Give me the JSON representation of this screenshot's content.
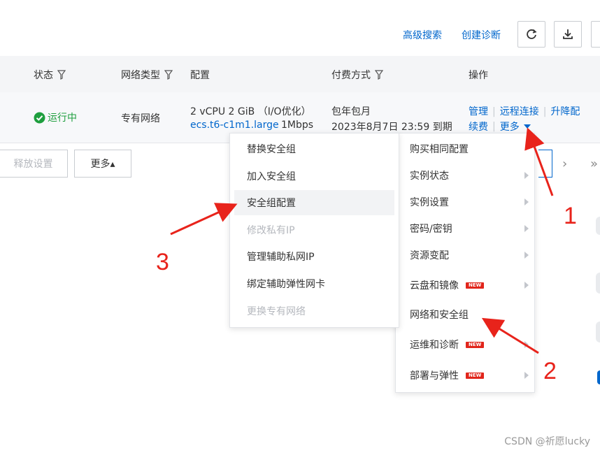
{
  "toolbar": {
    "advanced_search": "高级搜索",
    "create_diagnosis": "创建诊断"
  },
  "table": {
    "headers": {
      "status": "状态",
      "network_type": "网络类型",
      "config": "配置",
      "billing": "付费方式",
      "actions": "操作"
    },
    "row": {
      "status": "运行中",
      "network_type": "专有网络",
      "config_line1": "2 vCPU 2 GiB （I/O优化）",
      "instance_type": "ecs.t6-c1m1.large",
      "bandwidth": "1Mbps",
      "billing_line1": "包年包月",
      "billing_line2": "2023年8月7日 23:59 到期",
      "actions": {
        "manage": "管理",
        "remote_connect": "远程连接",
        "upgrade": "升降配",
        "renew": "续费",
        "more": "更多"
      }
    }
  },
  "bottom_buttons": {
    "release_settings": "释放设置",
    "more": "更多▴"
  },
  "pagination": {
    "next": "›",
    "last": "»"
  },
  "more_menu": {
    "items": [
      {
        "label": "购买相同配置"
      },
      {
        "label": "实例状态"
      },
      {
        "label": "实例设置"
      },
      {
        "label": "密码/密钥"
      },
      {
        "label": "资源变配"
      },
      {
        "label": "云盘和镜像",
        "badge": "NEW"
      },
      {
        "label": "网络和安全组"
      },
      {
        "label": "运维和诊断",
        "badge": "NEW"
      },
      {
        "label": "部署与弹性",
        "badge": "NEW"
      }
    ]
  },
  "network_submenu": {
    "items": [
      {
        "label": "替换安全组"
      },
      {
        "label": "加入安全组"
      },
      {
        "label": "安全组配置"
      },
      {
        "label": "修改私有IP"
      },
      {
        "label": "管理辅助私网IP"
      },
      {
        "label": "绑定辅助弹性网卡"
      },
      {
        "label": "更换专有网络"
      }
    ]
  },
  "annotations": {
    "one": "1",
    "two": "2",
    "three": "3"
  },
  "watermark": "CSDN @祈愿lucky",
  "colors": {
    "link": "#0066cc",
    "status_green": "#1e9e3e",
    "annotation_red": "#e8231b",
    "new_badge": "#e1251b"
  }
}
